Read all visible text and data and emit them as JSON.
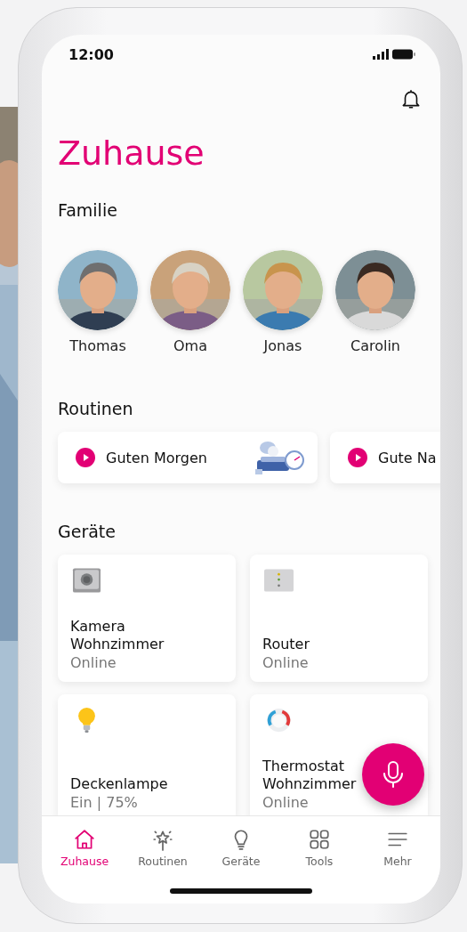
{
  "status_bar": {
    "time": "12:00"
  },
  "title": "Zuhause",
  "family": {
    "heading": "Familie",
    "members": [
      {
        "name": "Thomas",
        "kind": "picture"
      },
      {
        "name": "Oma",
        "kind": "picture"
      },
      {
        "name": "Jonas",
        "kind": "picture"
      },
      {
        "name": "Carolin",
        "kind": "picture"
      }
    ]
  },
  "routines": {
    "heading": "Routinen",
    "items": [
      {
        "label": "Guten Morgen",
        "kind": "illustrated"
      },
      {
        "label": "Gute Na",
        "kind": "plain"
      }
    ]
  },
  "devices": {
    "heading": "Geräte",
    "items": [
      {
        "name": "Kamera Wohnzimmer",
        "status": "Online",
        "kind": "camera"
      },
      {
        "name": "Router",
        "status": "Online",
        "kind": "router"
      },
      {
        "name": "Deckenlampe",
        "status": "Ein | 75%",
        "kind": "lamp"
      },
      {
        "name": "Thermostat Wohnzimmer",
        "status": "Online",
        "kind": "thermostat"
      }
    ]
  },
  "nav": [
    {
      "label": "Zuhause",
      "kind": "home",
      "selected": true
    },
    {
      "label": "Routinen",
      "kind": "routines",
      "selected": false
    },
    {
      "label": "Geräte",
      "kind": "devices",
      "selected": false
    },
    {
      "label": "Tools",
      "kind": "tools",
      "selected": false
    },
    {
      "label": "Mehr",
      "kind": "more",
      "selected": false
    }
  ]
}
